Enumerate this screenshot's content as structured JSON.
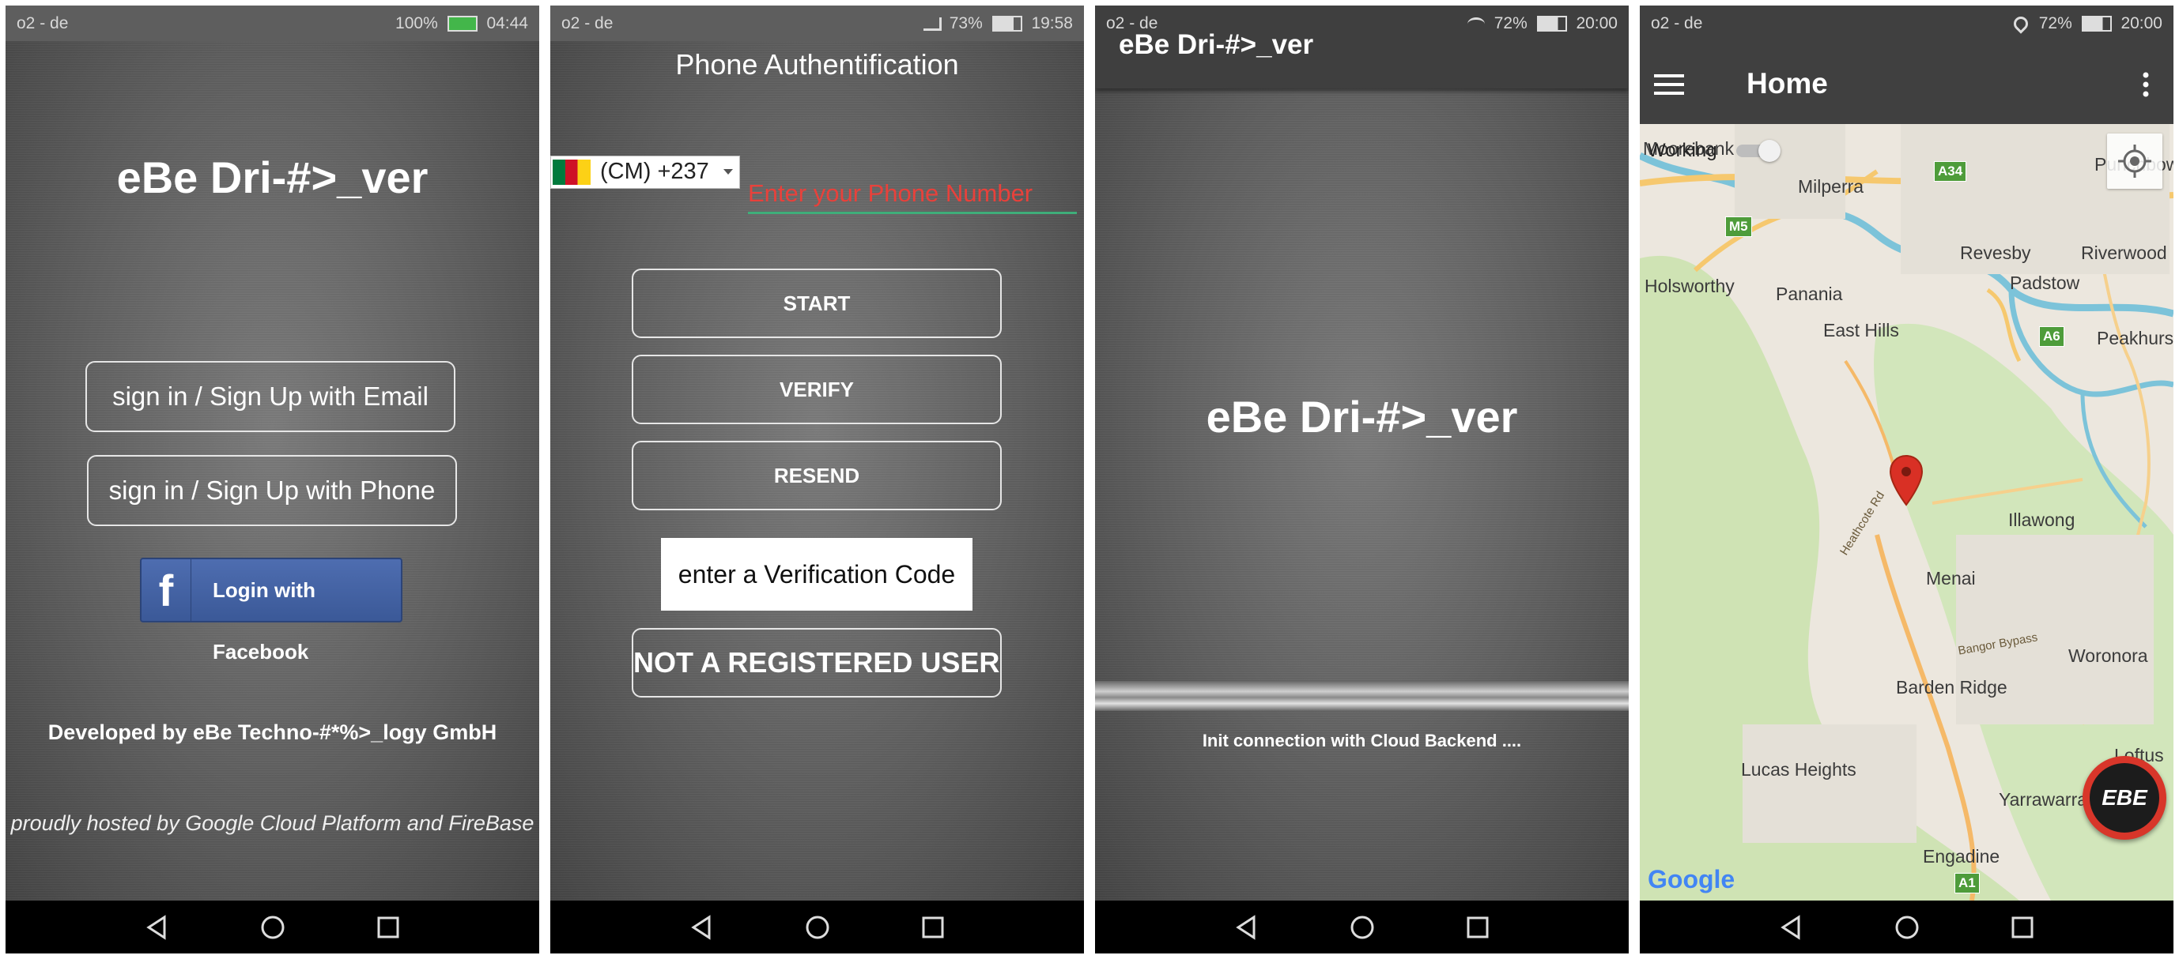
{
  "screen1": {
    "status": {
      "carrier": "o2 - de",
      "battery_pct": "100%",
      "time": "04:44"
    },
    "app_title": "eBe Dri-#>_ver",
    "email_button": "sign in / Sign Up with Email",
    "phone_button": "sign in / Sign Up with Phone",
    "facebook_button": "Login with Facebook",
    "developer": "Developed by eBe Techno-#*%>_logy GmbH",
    "hosted": "proudly hosted by Google Cloud Platform and FireBase"
  },
  "screen2": {
    "status": {
      "carrier": "o2 - de",
      "battery_pct": "73%",
      "time": "19:58"
    },
    "title": "Phone Authentification",
    "country_code": "(CM) +237",
    "phone_placeholder": "Enter your Phone Number",
    "start_button": "START",
    "verify_button": "VERIFY",
    "resend_button": "RESEND",
    "verification_placeholder": "enter a Verification Code",
    "not_registered_button": "NOT A REGISTERED USER ?"
  },
  "screen3": {
    "status": {
      "carrier": "o2 - de",
      "battery_pct": "72%",
      "time": "20:00"
    },
    "toolbar_title": "eBe Dri-#>_ver",
    "app_title": "eBe Dri-#>_ver",
    "message": "Init connection with Cloud Backend ...."
  },
  "screen4": {
    "status": {
      "carrier": "o2 - de",
      "battery_pct": "72%",
      "time": "20:00"
    },
    "toolbar_title": "Home",
    "working_label": "Working",
    "map_labels": [
      "Moorebank",
      "Milperra",
      "Punchbowl",
      "Revesby",
      "Riverwood",
      "Holsworthy",
      "Panania",
      "Padstow",
      "East Hills",
      "Peakhurst",
      "Illawong",
      "Menai",
      "Woronora",
      "Barden Ridge",
      "Lucas Heights",
      "Yarrawarrah",
      "Engadine",
      "Loftus",
      "Heathcote Rd",
      "Bangor Bypass"
    ],
    "road_shields": [
      "A34",
      "M5",
      "A6",
      "A1"
    ],
    "google_logo": "Google",
    "fab_label": "EBE"
  },
  "colors": {
    "placeholder_red": "#e8413b",
    "underline_green": "#3fae7a",
    "facebook_blue": "#3b5998",
    "toolbar_dark": "#404040",
    "map_pin_red": "#d93025"
  }
}
